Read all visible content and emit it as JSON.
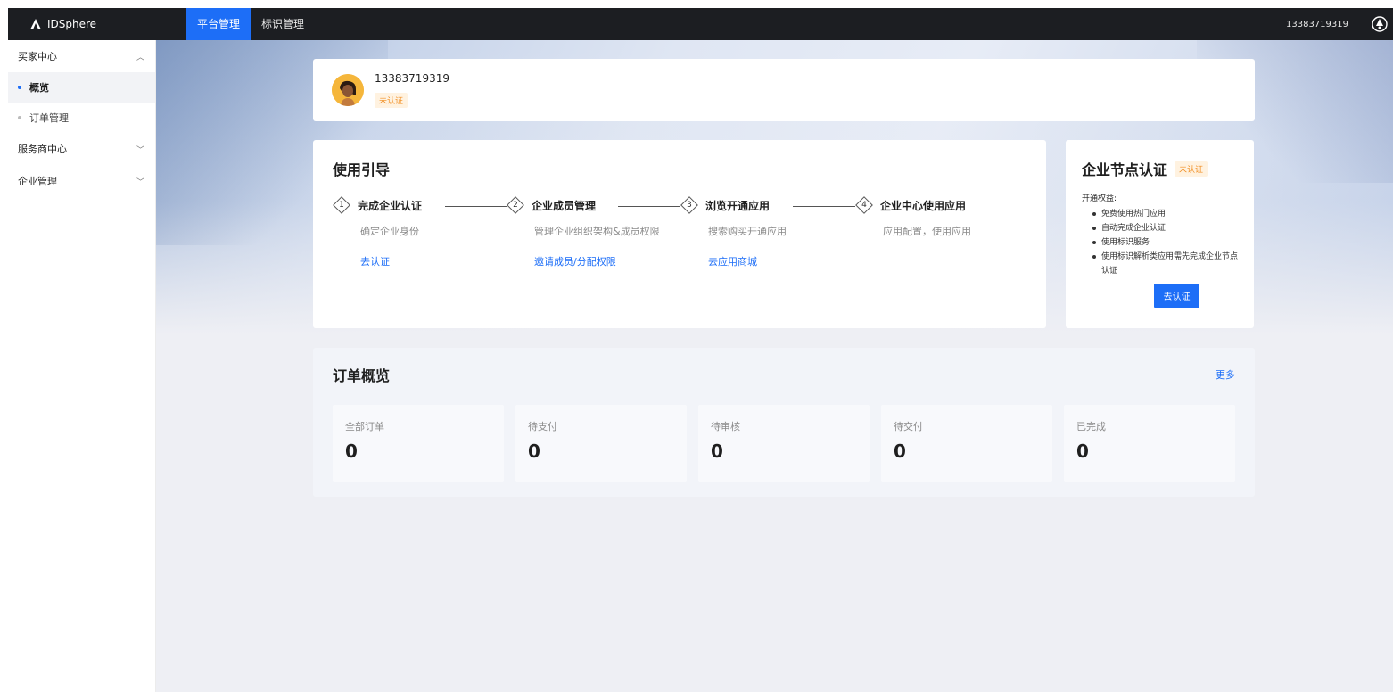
{
  "app": {
    "brand": "IDSphere",
    "top_tabs": [
      {
        "label": "平台管理",
        "active": true
      },
      {
        "label": "标识管理",
        "active": false
      }
    ],
    "user": "13383719319",
    "accent_color": "#1d6ef7"
  },
  "sidebar": {
    "groups": [
      {
        "label": "买家中心",
        "expanded": true
      },
      {
        "label": "服务商中心",
        "expanded": false
      },
      {
        "label": "企业管理",
        "expanded": false
      }
    ],
    "items": [
      {
        "label": "概览",
        "active": true
      },
      {
        "label": "订单管理",
        "active": false
      }
    ]
  },
  "profile": {
    "phone": "13383719319",
    "status": "未认证"
  },
  "guide": {
    "title": "使用引导",
    "steps": [
      {
        "num": "1",
        "name": "完成企业认证",
        "desc": "确定企业身份",
        "link": "去认证"
      },
      {
        "num": "2",
        "name": "企业成员管理",
        "desc": "管理企业组织架构&成员权限",
        "link": "邀请成员/分配权限"
      },
      {
        "num": "3",
        "name": "浏览开通应用",
        "desc": "搜索购买开通应用",
        "link": "去应用商城"
      },
      {
        "num": "4",
        "name": "企业中心使用应用",
        "desc": "应用配置，使用应用",
        "link": ""
      }
    ]
  },
  "node_cert": {
    "title": "企业节点认证",
    "status": "未认证",
    "benefits_title": "开通权益:",
    "benefits": [
      "免费使用热门应用",
      "自动完成企业认证",
      "使用标识服务",
      "使用标识解析类应用需先完成企业节点认证"
    ],
    "button": "去认证"
  },
  "orders": {
    "title": "订单概览",
    "more": "更多",
    "stats": [
      {
        "label": "全部订单",
        "value": "0"
      },
      {
        "label": "待支付",
        "value": "0"
      },
      {
        "label": "待审核",
        "value": "0"
      },
      {
        "label": "待交付",
        "value": "0"
      },
      {
        "label": "已完成",
        "value": "0"
      }
    ]
  }
}
